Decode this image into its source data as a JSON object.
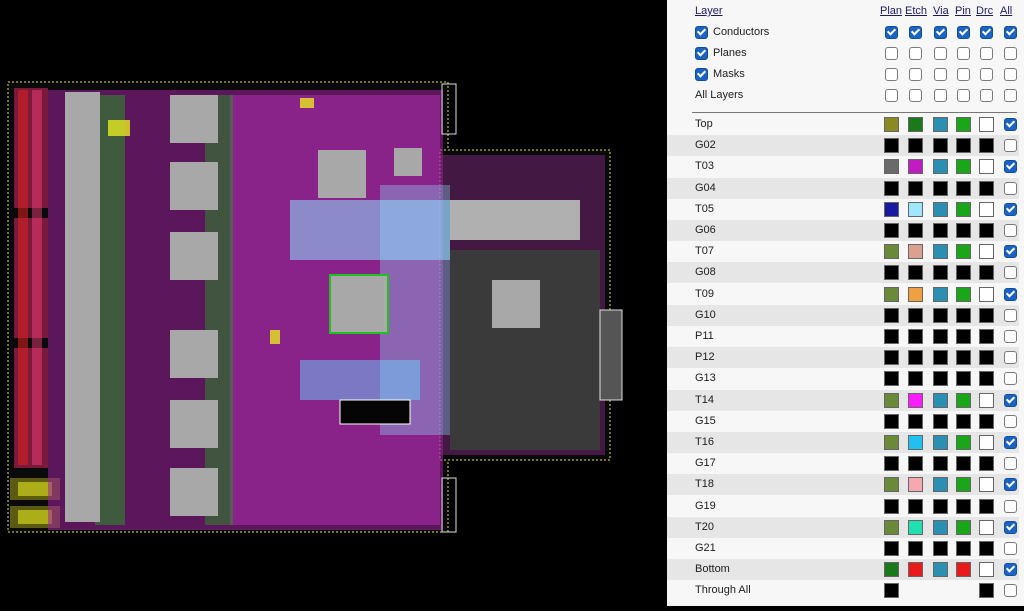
{
  "layer_panel": {
    "headers": {
      "layer": "Layer",
      "plan": "Plan",
      "etch": "Etch",
      "via": "Via",
      "pin": "Pin",
      "drc": "Drc",
      "all": "All"
    },
    "groups": [
      {
        "label": "Conductors",
        "checked": true,
        "cols": [
          true,
          true,
          true,
          true,
          true,
          true
        ]
      },
      {
        "label": "Planes",
        "checked": true,
        "cols": [
          false,
          false,
          false,
          false,
          false,
          false
        ]
      },
      {
        "label": "Masks",
        "checked": true,
        "cols": [
          false,
          false,
          false,
          false,
          false,
          false
        ]
      },
      {
        "label": "All Layers",
        "checked": false,
        "cols": [
          false,
          false,
          false,
          false,
          false,
          false
        ]
      }
    ],
    "layers": [
      {
        "name": "Top",
        "plan": "#8a8a20",
        "etch": "#1a7a1a",
        "via": "#2a8fb0",
        "pin": "#19a619",
        "drc": "#ffffff",
        "all": true
      },
      {
        "name": "G02",
        "plan": "#000000",
        "etch": "#000000",
        "via": "#000000",
        "pin": "#000000",
        "drc": "#000000",
        "all": false
      },
      {
        "name": "T03",
        "plan": "#6a6a6a",
        "etch": "#c11cc1",
        "via": "#2a8fb0",
        "pin": "#19a619",
        "drc": "#ffffff",
        "all": true
      },
      {
        "name": "G04",
        "plan": "#000000",
        "etch": "#000000",
        "via": "#000000",
        "pin": "#000000",
        "drc": "#000000",
        "all": false
      },
      {
        "name": "T05",
        "plan": "#1a1aa0",
        "etch": "#9fe6ff",
        "via": "#2a8fb0",
        "pin": "#19a619",
        "drc": "#ffffff",
        "all": true
      },
      {
        "name": "G06",
        "plan": "#000000",
        "etch": "#000000",
        "via": "#000000",
        "pin": "#000000",
        "drc": "#000000",
        "all": false
      },
      {
        "name": "T07",
        "plan": "#6a8a3a",
        "etch": "#dba090",
        "via": "#2a8fb0",
        "pin": "#19a619",
        "drc": "#ffffff",
        "all": true
      },
      {
        "name": "G08",
        "plan": "#000000",
        "etch": "#000000",
        "via": "#000000",
        "pin": "#000000",
        "drc": "#000000",
        "all": false
      },
      {
        "name": "T09",
        "plan": "#6a8a3a",
        "etch": "#f0a040",
        "via": "#2a8fb0",
        "pin": "#19a619",
        "drc": "#ffffff",
        "all": true
      },
      {
        "name": "G10",
        "plan": "#000000",
        "etch": "#000000",
        "via": "#000000",
        "pin": "#000000",
        "drc": "#000000",
        "all": false
      },
      {
        "name": "P11",
        "plan": "#000000",
        "etch": "#000000",
        "via": "#000000",
        "pin": "#000000",
        "drc": "#000000",
        "all": false
      },
      {
        "name": "P12",
        "plan": "#000000",
        "etch": "#000000",
        "via": "#000000",
        "pin": "#000000",
        "drc": "#000000",
        "all": false
      },
      {
        "name": "G13",
        "plan": "#000000",
        "etch": "#000000",
        "via": "#000000",
        "pin": "#000000",
        "drc": "#000000",
        "all": false
      },
      {
        "name": "T14",
        "plan": "#6a8a3a",
        "etch": "#ff1cff",
        "via": "#2a8fb0",
        "pin": "#19a619",
        "drc": "#ffffff",
        "all": true
      },
      {
        "name": "G15",
        "plan": "#000000",
        "etch": "#000000",
        "via": "#000000",
        "pin": "#000000",
        "drc": "#000000",
        "all": false
      },
      {
        "name": "T16",
        "plan": "#6a8a3a",
        "etch": "#20c0f0",
        "via": "#2a8fb0",
        "pin": "#19a619",
        "drc": "#ffffff",
        "all": true
      },
      {
        "name": "G17",
        "plan": "#000000",
        "etch": "#000000",
        "via": "#000000",
        "pin": "#000000",
        "drc": "#000000",
        "all": false
      },
      {
        "name": "T18",
        "plan": "#6a8a3a",
        "etch": "#f5a8b0",
        "via": "#2a8fb0",
        "pin": "#19a619",
        "drc": "#ffffff",
        "all": true
      },
      {
        "name": "G19",
        "plan": "#000000",
        "etch": "#000000",
        "via": "#000000",
        "pin": "#000000",
        "drc": "#000000",
        "all": false
      },
      {
        "name": "T20",
        "plan": "#6a8a3a",
        "etch": "#20e0b0",
        "via": "#2a8fb0",
        "pin": "#19a619",
        "drc": "#ffffff",
        "all": true
      },
      {
        "name": "G21",
        "plan": "#000000",
        "etch": "#000000",
        "via": "#000000",
        "pin": "#000000",
        "drc": "#000000",
        "all": false
      },
      {
        "name": "Bottom",
        "plan": "#1a7a1a",
        "etch": "#e81a1a",
        "via": "#2a8fb0",
        "pin": "#e81a1a",
        "drc": "#ffffff",
        "all": true
      },
      {
        "name": "Through All",
        "plan": "#000000",
        "etch": null,
        "via": null,
        "pin": null,
        "drc": "#000000",
        "all": false
      }
    ]
  }
}
